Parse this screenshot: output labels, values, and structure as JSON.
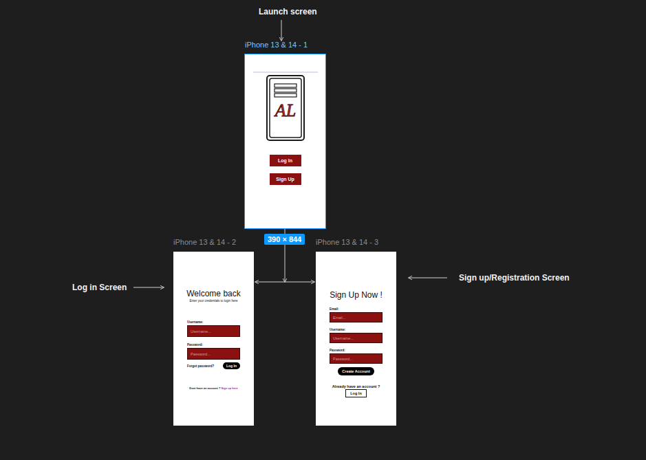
{
  "annotations": {
    "launch": "Launch screen",
    "login": "Log in Screen",
    "signup": "Sign up/Registration Screen"
  },
  "size_badge": "390 × 844",
  "frames": [
    {
      "name": "iPhone 13 & 14 - 1",
      "selected": true
    },
    {
      "name": "iPhone 13 & 14 - 2",
      "selected": false
    },
    {
      "name": "iPhone 13 & 14 - 3",
      "selected": false
    }
  ],
  "launch_screen": {
    "logo_text": "AL",
    "buttons": [
      "Log In",
      "Sign Up"
    ]
  },
  "login_screen": {
    "title": "Welcome back",
    "subtitle": "Enter your credentials to login here",
    "fields": [
      {
        "label": "Username:",
        "placeholder": "Username..."
      },
      {
        "label": "Password:",
        "placeholder": "Password..."
      }
    ],
    "forgot": "Forgot password?",
    "submit": "Log In",
    "footer_text": "Dont have an account ?",
    "footer_link": "Sign up here"
  },
  "signup_screen": {
    "title": "Sign Up Now !",
    "fields": [
      {
        "label": "Email:",
        "placeholder": "Email..."
      },
      {
        "label": "Username:",
        "placeholder": "Username..."
      },
      {
        "label": "Password:",
        "placeholder": "Password..."
      }
    ],
    "submit": "Create Account",
    "footer_text": "Already have an account ?",
    "footer_button": "Log In"
  }
}
